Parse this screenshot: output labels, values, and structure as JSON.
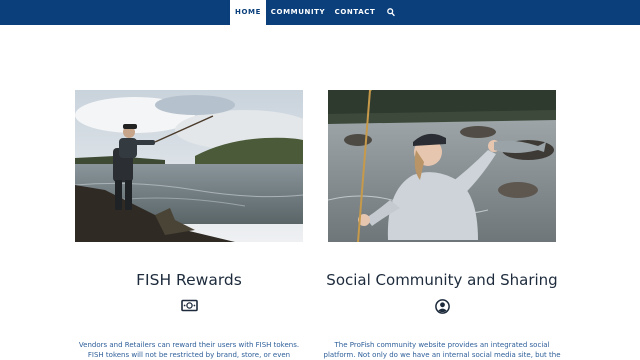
{
  "nav": {
    "items": [
      {
        "label": "HOME"
      },
      {
        "label": "COMMUNITY"
      },
      {
        "label": "CONTACT"
      }
    ],
    "search_icon": "search-icon",
    "colors": {
      "bar": "#0b3f7c",
      "active_bg": "#ffffff",
      "active_text": "#0b3f7c"
    }
  },
  "features": {
    "left": {
      "title": "FISH Rewards",
      "icon": "money-bill-icon",
      "text": "Vendors and Retailers can reward their users with FISH tokens. FISH tokens will not be restricted by brand, store, or even borders. FISH"
    },
    "right": {
      "title": "Social Community and Sharing",
      "icon": "user-circle-icon",
      "text": "The ProFish community website provides an integrated social platform. Not only do we have an internal social media site, but the ProFish site"
    }
  },
  "colors": {
    "title": "#1d2b3c",
    "body_text": "#2d5e99"
  }
}
